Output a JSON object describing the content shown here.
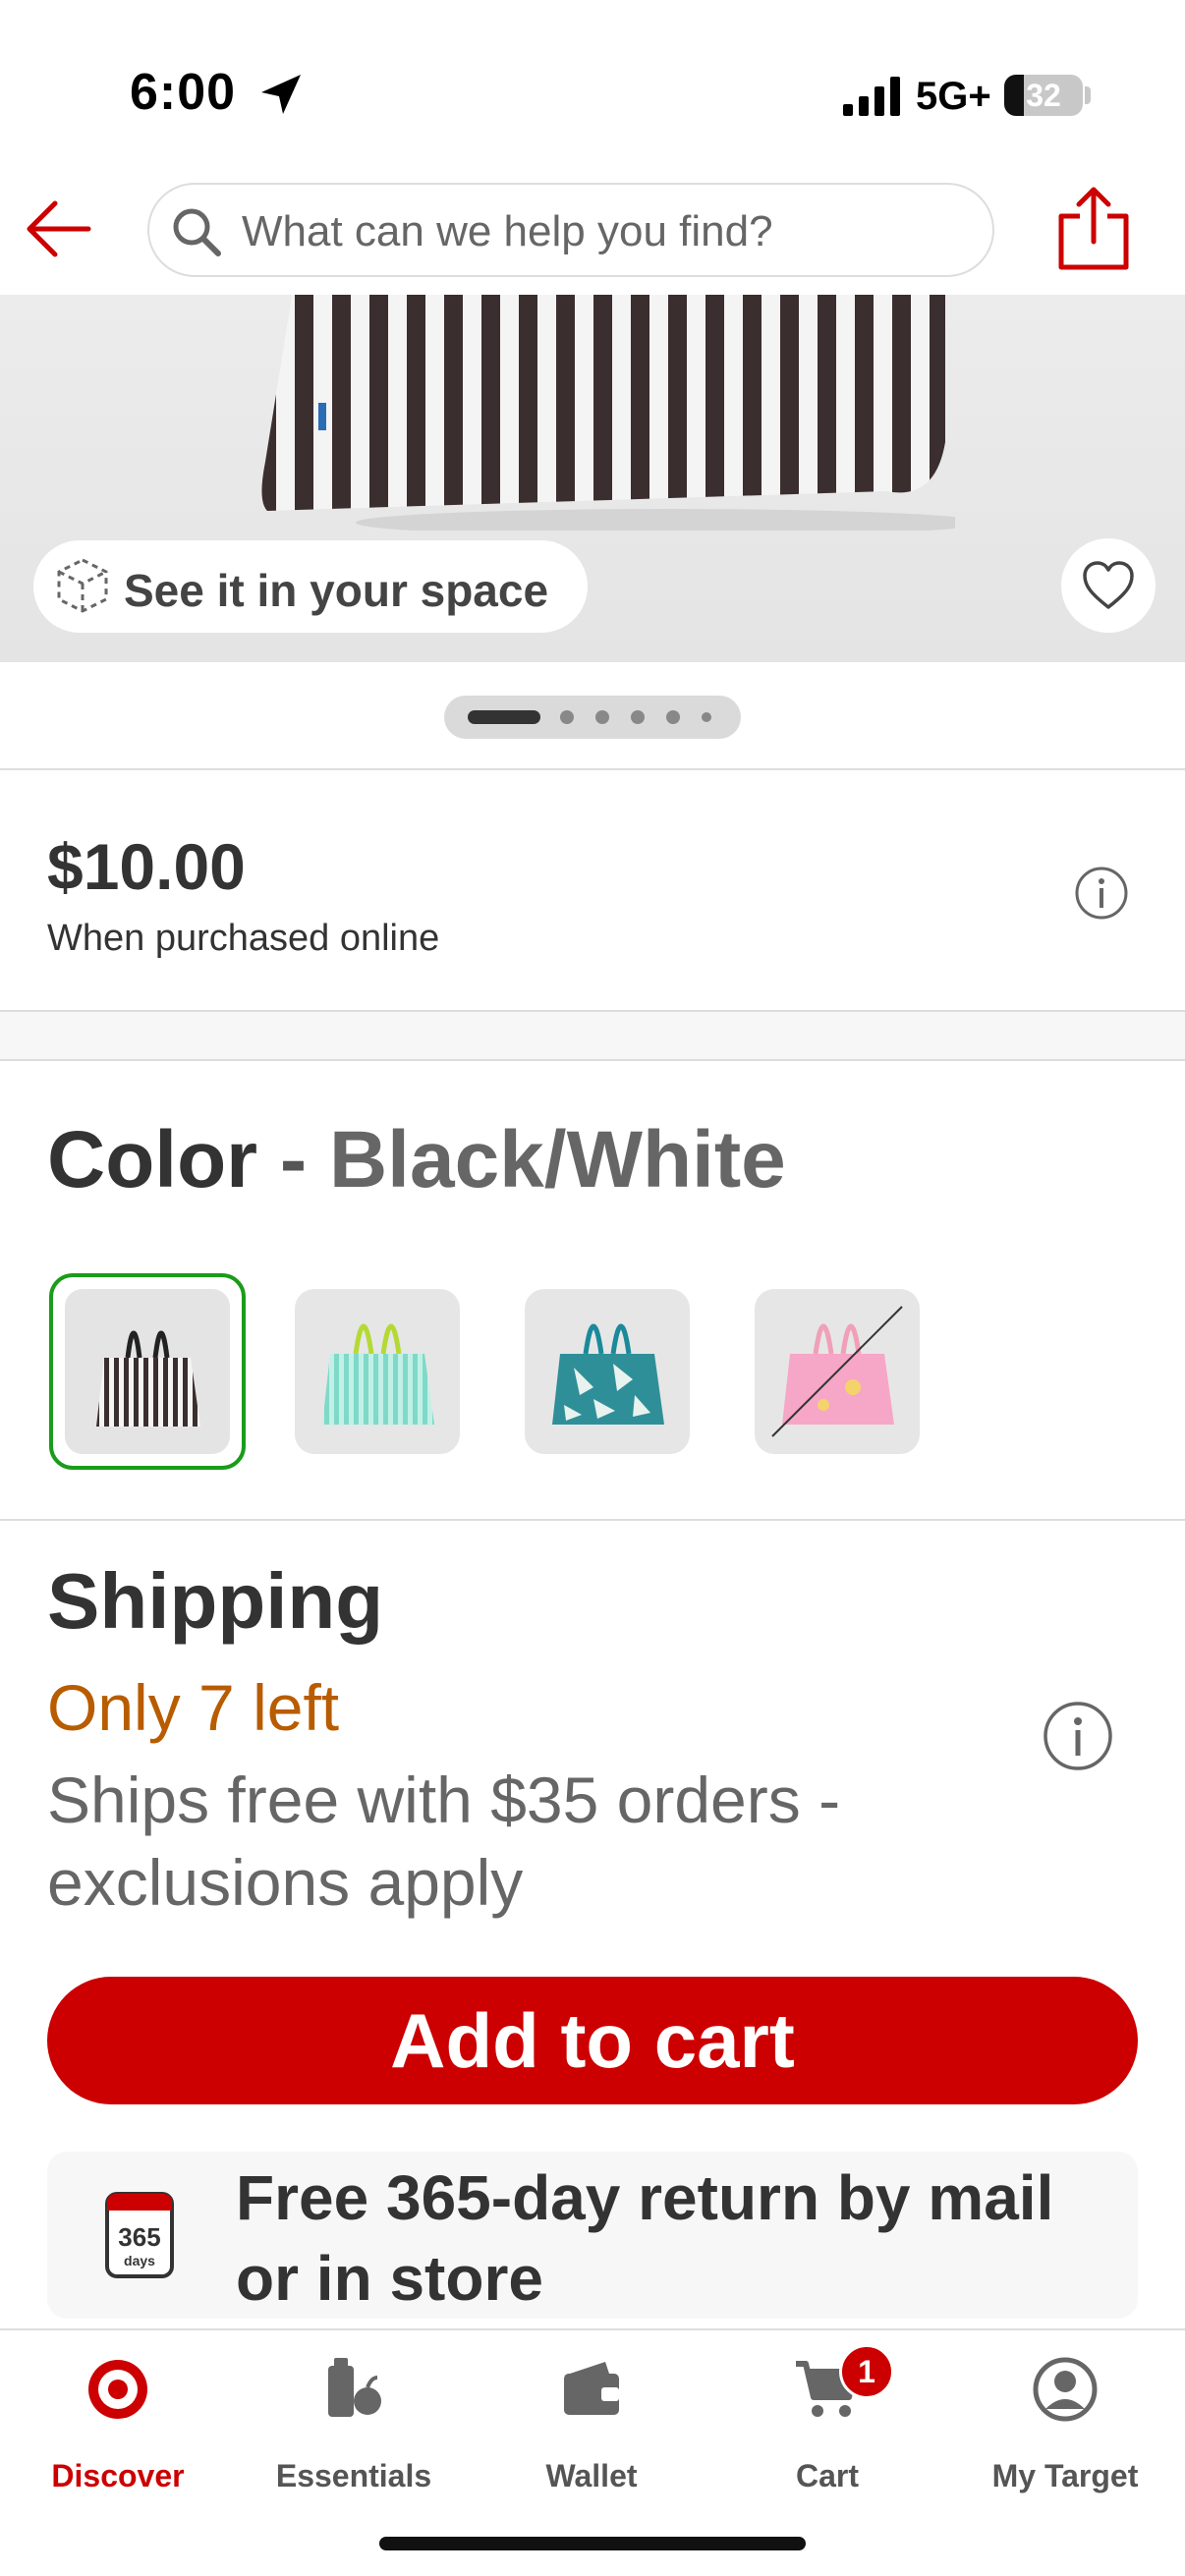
{
  "status_bar": {
    "time": "6:00",
    "network": "5G+",
    "battery": "32"
  },
  "header": {
    "search_placeholder": "What can we help you find?"
  },
  "product_image": {
    "ar_label": "See it in your space",
    "carousel_dot_count": 6,
    "carousel_active_index": 0
  },
  "price": {
    "amount": "$10.00",
    "note": "When purchased online"
  },
  "color": {
    "heading": "Color",
    "separator": " - ",
    "selected": "Black/White",
    "swatches": [
      {
        "name": "black-white-stripe",
        "selected": true,
        "available": true
      },
      {
        "name": "mint-stripe",
        "selected": false,
        "available": true
      },
      {
        "name": "teal-palm",
        "selected": false,
        "available": true
      },
      {
        "name": "pink",
        "selected": false,
        "available": false
      }
    ]
  },
  "shipping": {
    "heading": "Shipping",
    "stock": "Only 7 left",
    "note": "Ships free with $35 orders - exclusions apply"
  },
  "add_to_cart": "Add to cart",
  "returns": {
    "icon_number": "365",
    "icon_unit": "days",
    "text": "Free 365-day return by mail or in store"
  },
  "tabbar": {
    "tabs": [
      {
        "label": "Discover",
        "active": true
      },
      {
        "label": "Essentials",
        "active": false
      },
      {
        "label": "Wallet",
        "active": false
      },
      {
        "label": "Cart",
        "active": false,
        "badge": "1"
      },
      {
        "label": "My Target",
        "active": false
      }
    ]
  },
  "colors": {
    "brand_red": "#cc0000",
    "selected_green": "#1a9c1a",
    "stock_orange": "#b85c00"
  }
}
